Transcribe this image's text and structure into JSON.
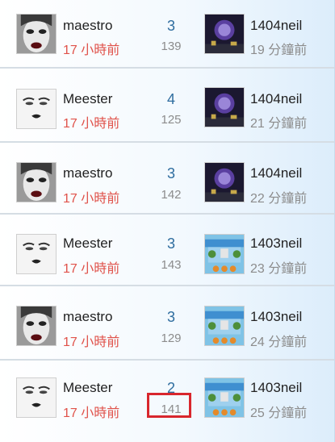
{
  "threads": [
    {
      "user": "maestro",
      "user_time": "17 小時前",
      "replies": "3",
      "views": "139",
      "last_user": "1404neil",
      "last_time": "19 分鐘前",
      "avatar_icon": "avatar-woman-red-lips",
      "thumb_icon": "fireworks-thumbnail"
    },
    {
      "user": "Meester",
      "user_time": "17 小時前",
      "replies": "4",
      "views": "125",
      "last_user": "1404neil",
      "last_time": "21 分鐘前",
      "avatar_icon": "avatar-face-sketch",
      "thumb_icon": "fireworks-thumbnail"
    },
    {
      "user": "maestro",
      "user_time": "17 小時前",
      "replies": "3",
      "views": "142",
      "last_user": "1404neil",
      "last_time": "22 分鐘前",
      "avatar_icon": "avatar-woman-red-lips",
      "thumb_icon": "fireworks-thumbnail"
    },
    {
      "user": "Meester",
      "user_time": "17 小時前",
      "replies": "3",
      "views": "143",
      "last_user": "1403neil",
      "last_time": "23 分鐘前",
      "avatar_icon": "avatar-face-sketch",
      "thumb_icon": "playground-thumbnail"
    },
    {
      "user": "maestro",
      "user_time": "17 小時前",
      "replies": "3",
      "views": "129",
      "last_user": "1403neil",
      "last_time": "24 分鐘前",
      "avatar_icon": "avatar-woman-red-lips",
      "thumb_icon": "playground-thumbnail"
    },
    {
      "user": "Meester",
      "user_time": "17 小時前",
      "replies": "2",
      "views": "141",
      "last_user": "1403neil",
      "last_time": "25 分鐘前",
      "avatar_icon": "avatar-face-sketch",
      "thumb_icon": "playground-thumbnail"
    }
  ],
  "colors": {
    "accent_blue": "#2f6d9f",
    "time_red": "#e0524a",
    "muted_gray": "#8c8c8c",
    "highlight_red": "#d8262d"
  }
}
